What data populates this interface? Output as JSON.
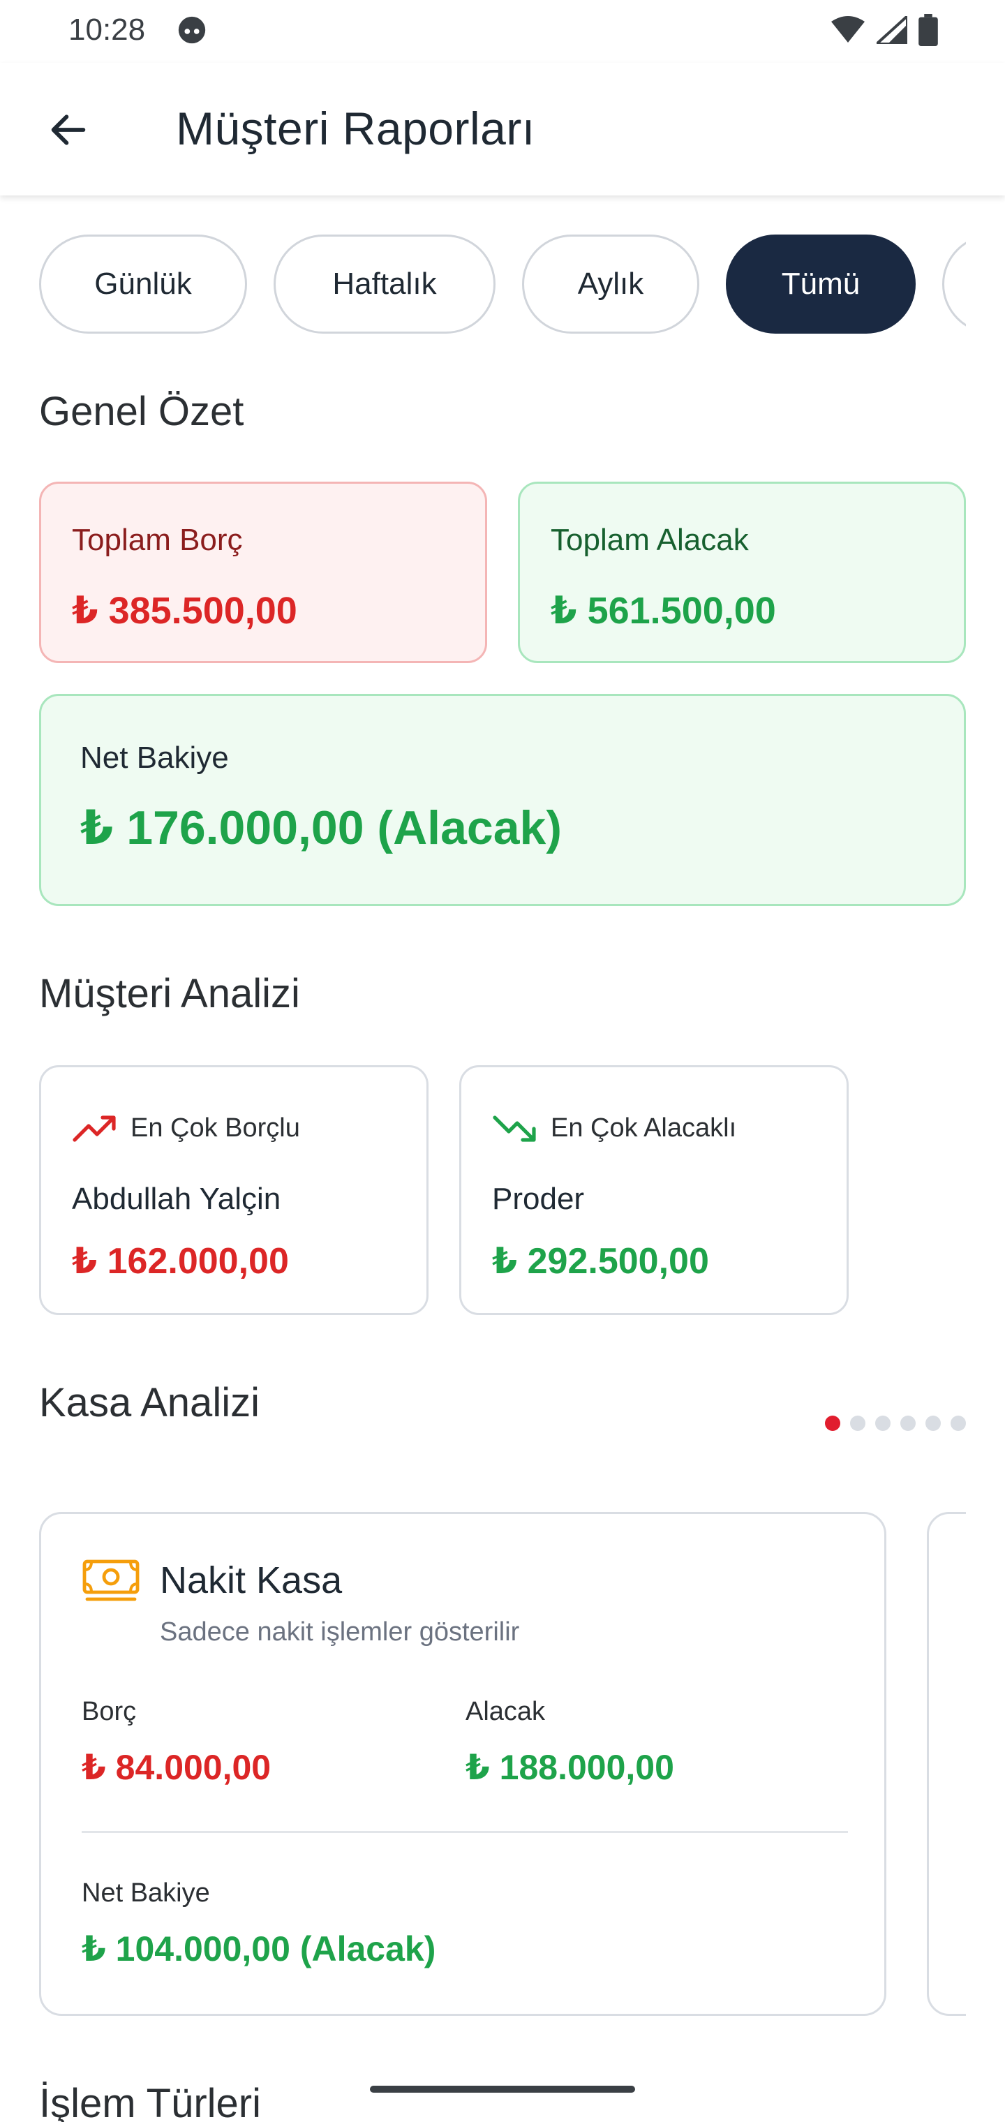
{
  "status_bar": {
    "time": "10:28"
  },
  "app_bar": {
    "title": "Müşteri Raporları"
  },
  "filters": {
    "chips": [
      "Günlük",
      "Haftalık",
      "Aylık",
      "Tümü"
    ],
    "active": "Tümü"
  },
  "summary": {
    "heading": "Genel Özet",
    "total_debt": {
      "label": "Toplam Borç",
      "value": "₺ 385.500,00"
    },
    "total_credit": {
      "label": "Toplam Alacak",
      "value": "₺ 561.500,00"
    },
    "net_balance": {
      "label": "Net Bakiye",
      "value": "₺ 176.000,00 (Alacak)"
    }
  },
  "customer_analysis": {
    "heading": "Müşteri Analizi",
    "top_debtor": {
      "label": "En Çok Borçlu",
      "name": "Abdullah Yalçin",
      "amount": "₺ 162.000,00",
      "icon": "trending-up-icon"
    },
    "top_creditor": {
      "label": "En Çok Alacaklı",
      "name": "Proder",
      "amount": "₺ 292.500,00",
      "icon": "trending-down-icon"
    }
  },
  "cash_analysis": {
    "heading": "Kasa Analizi",
    "page_count": 6,
    "current_page": 1,
    "card": {
      "title": "Nakit Kasa",
      "subtitle": "Sadece nakit işlemler gösterilir",
      "icon": "cash-icon",
      "debt_label": "Borç",
      "debt_value": "₺ 84.000,00",
      "credit_label": "Alacak",
      "credit_value": "₺ 188.000,00",
      "net_label": "Net Bakiye",
      "net_value": "₺ 104.000,00 (Alacak)"
    }
  },
  "next_section": {
    "heading": "İşlem Türleri"
  },
  "colors": {
    "accent_dark": "#1a2942",
    "debt_red": "#dc2626",
    "credit_green": "#1ea34a",
    "pager_active": "#e11d2e"
  }
}
